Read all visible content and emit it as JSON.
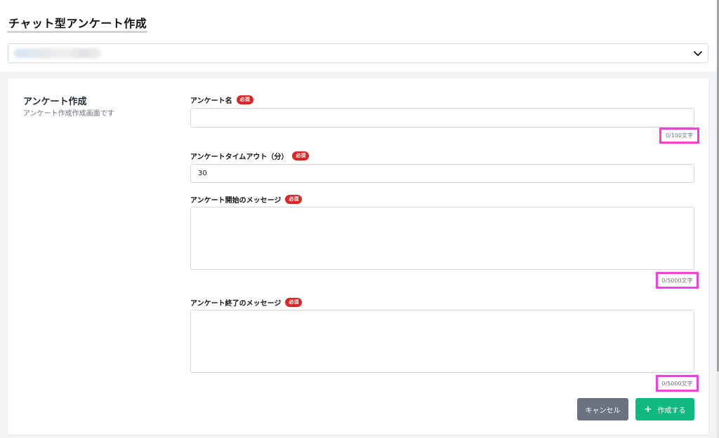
{
  "header": {
    "title": "チャット型アンケート作成"
  },
  "selector": {
    "value": "",
    "icon": "chevron-down-icon"
  },
  "section": {
    "title": "アンケート作成",
    "description": "アンケート作成作成画面です"
  },
  "fields": {
    "name": {
      "label": "アンケート名",
      "badge": "必須",
      "value": "",
      "counter": "0/100文字"
    },
    "timeout": {
      "label": "アンケートタイムアウト（分）",
      "badge": "必須",
      "value": "30"
    },
    "start_message": {
      "label": "アンケート開始のメッセージ",
      "badge": "必須",
      "value": "",
      "counter": "0/5000文字"
    },
    "end_message": {
      "label": "アンケート終了のメッセージ",
      "badge": "必須",
      "value": "",
      "counter": "0/5000文字"
    }
  },
  "buttons": {
    "cancel": "キャンセル",
    "create": "作成する",
    "create_icon": "plus-icon"
  },
  "colors": {
    "required_badge": "#dc2626",
    "create_button": "#10b981",
    "cancel_button": "#6b7280",
    "highlight_box": "#f03ee0"
  }
}
